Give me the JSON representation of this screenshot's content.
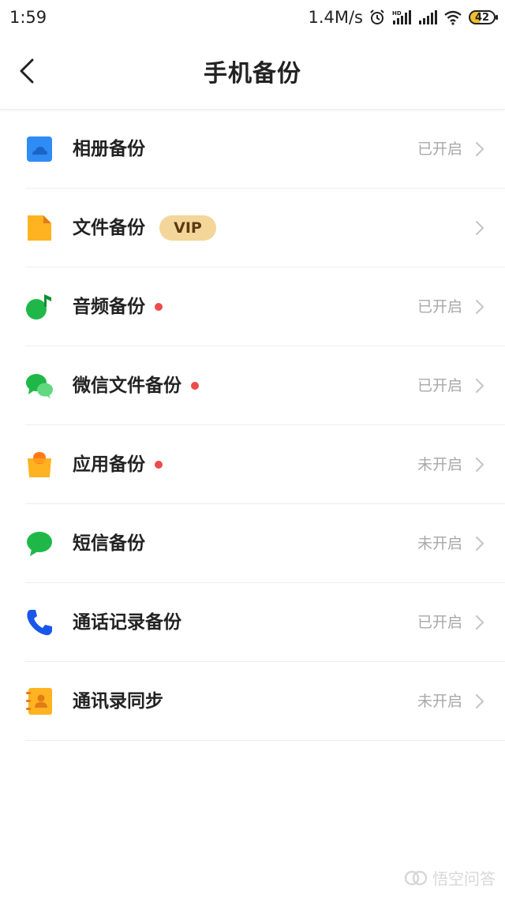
{
  "status_bar": {
    "time": "1:59",
    "speed": "1.4M/s",
    "battery": "42"
  },
  "header": {
    "title": "手机备份"
  },
  "items": [
    {
      "label": "相册备份",
      "status": "已开启",
      "icon": "cloud-photo-icon"
    },
    {
      "label": "文件备份",
      "status": "",
      "badge": "VIP",
      "icon": "file-icon"
    },
    {
      "label": "音频备份",
      "status": "已开启",
      "dot": true,
      "icon": "music-note-icon"
    },
    {
      "label": "微信文件备份",
      "status": "已开启",
      "dot": true,
      "icon": "wechat-icon"
    },
    {
      "label": "应用备份",
      "status": "未开启",
      "dot": true,
      "icon": "app-bag-icon"
    },
    {
      "label": "短信备份",
      "status": "未开启",
      "icon": "sms-bubble-icon"
    },
    {
      "label": "通话记录备份",
      "status": "已开启",
      "icon": "phone-icon"
    },
    {
      "label": "通讯录同步",
      "status": "未开启",
      "icon": "contacts-book-icon"
    }
  ],
  "watermark": "悟空问答",
  "colors": {
    "blue": "#2f8cf4",
    "orange": "#ffb320",
    "green": "#1fb848",
    "red_dot": "#ee4a4a",
    "vip_bg": "#f4d69a",
    "status_gray": "#a8a8a8"
  }
}
